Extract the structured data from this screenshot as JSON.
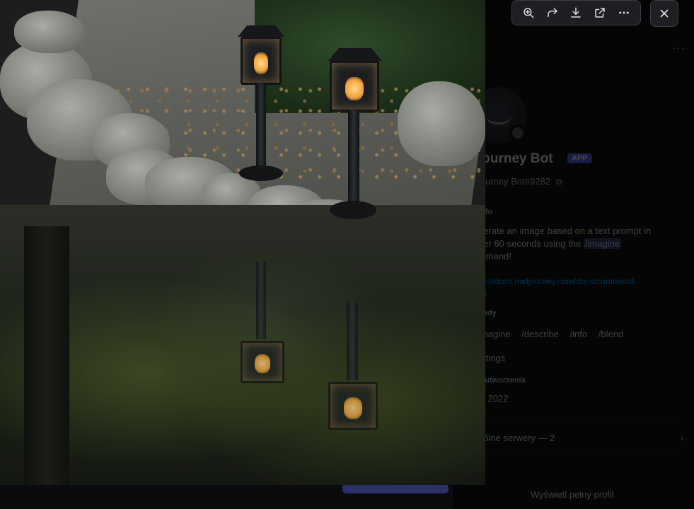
{
  "profile": {
    "name": "journey Bot",
    "badge": "APP",
    "tag": "journey Bot#9282",
    "about_heading": "Info",
    "about_text_before": "nerate an image based on a text prompt in",
    "about_text_line2": "der 60 seconds using the",
    "about_cmd": "/imagine",
    "about_text_line3": "mmand!",
    "link_text": "ps://docs.midjourney.com/docs/command-",
    "link_text2": "ist",
    "commands_heading": "endy",
    "commands": [
      "imagine",
      "/describe",
      "/info",
      "/blend"
    ],
    "settings_heading": "ettings",
    "created_heading": "a utworzenia",
    "created_value": "ty 2022",
    "mutual_servers": "pólne serwery — 2",
    "full_profile": "Wyświetl pełny profil"
  },
  "toolbar": {
    "zoom": "zoom-in-icon",
    "forward": "forward-icon",
    "download": "download-icon",
    "open": "open-in-browser-icon",
    "more": "more-icon",
    "close": "close-icon"
  },
  "colors": {
    "accent": "#5865f2",
    "toolbar_bg": "#1e1f22",
    "link": "#00a8fc"
  }
}
